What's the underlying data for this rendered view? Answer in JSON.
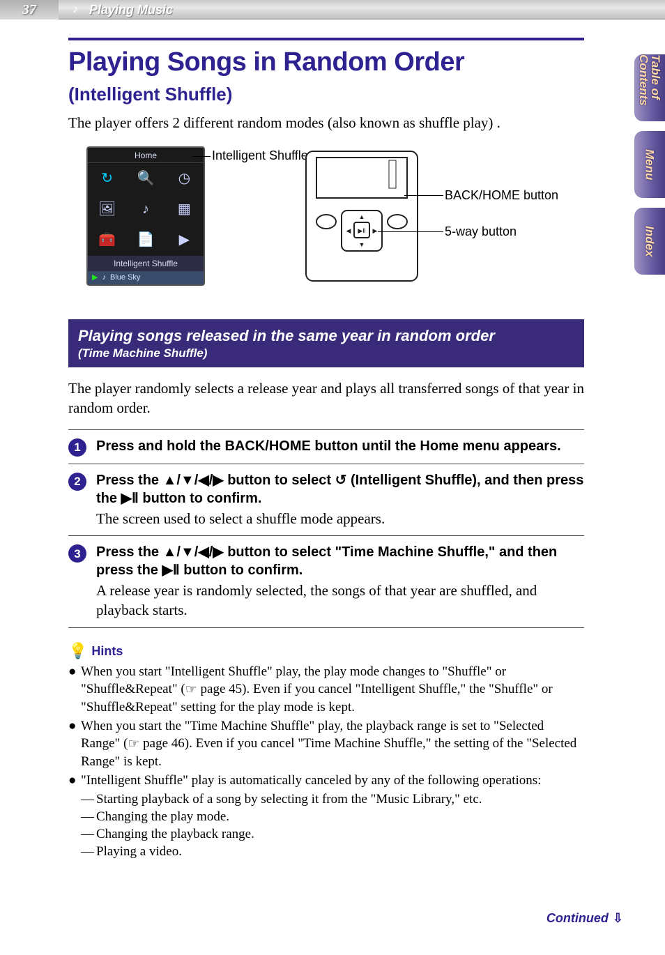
{
  "page_number": "37",
  "top_section": "Playing Music",
  "side_tabs": [
    "Table of Contents",
    "Menu",
    "Index"
  ],
  "title_main": "Playing Songs in Random Order",
  "title_sub": "(Intelligent Shuffle)",
  "intro": "The player offers 2 different random modes (also known as shuffle play) .",
  "device_screen": {
    "title": "Home",
    "selected_label": "Intelligent Shuffle",
    "now_playing": "Blue Sky"
  },
  "fig_labels": {
    "intelligent_shuffle": "Intelligent Shuffle",
    "back_home": "BACK/HOME button",
    "five_way": "5-way button"
  },
  "purple_bar": {
    "main": "Playing songs released in the same year in random order",
    "sub": "(Time Machine Shuffle)"
  },
  "body_after_bar": "The player randomly selects a release year and plays all transferred songs of that year in random order.",
  "steps": [
    {
      "num": "1",
      "bold": "Press and hold the BACK/HOME button until the Home menu appears.",
      "text": ""
    },
    {
      "num": "2",
      "bold_pre": "Press the ",
      "nav": "▲/▼/◀/▶",
      "bold_mid1": " button to select ",
      "icon_name": "intelligent-shuffle-feature-icon",
      "bold_mid2": " (Intelligent Shuffle), and then press the ",
      "play": "▶Ⅱ",
      "bold_post": " button to confirm.",
      "text": "The screen used to select a shuffle mode appears."
    },
    {
      "num": "3",
      "bold_pre": "Press the ",
      "nav": "▲/▼/◀/▶",
      "bold_mid": " button to select \"Time Machine Shuffle,\" and then press the ",
      "play": "▶Ⅱ",
      "bold_post": " button to confirm.",
      "text": "A release year is randomly selected, the songs of that year are shuffled, and playback starts."
    }
  ],
  "hints_title": "Hints",
  "hints": [
    {
      "pre": "When you start \"Intelligent Shuffle\" play, the play mode changes to \"Shuffle\" or \"Shuffle&Repeat\" (",
      "ref": "☞",
      "page": " page 45",
      "post": "). Even if you cancel \"Intelligent Shuffle,\" the \"Shuffle\" or \"Shuffle&Repeat\" setting for the play mode is kept."
    },
    {
      "pre": "When you start the \"Time Machine Shuffle\" play, the playback range is set to \"Selected Range\" (",
      "ref": "☞",
      "page": " page 46",
      "post": "). Even if you cancel \"Time Machine Shuffle,\" the setting of the \"Selected Range\" is kept."
    },
    {
      "line": "\"Intelligent Shuffle\" play is automatically canceled by any of the following operations:",
      "subs": [
        "Starting playback of a song by selecting it from the \"Music Library,\" etc.",
        "Changing the play mode.",
        "Changing the playback range.",
        "Playing a video."
      ]
    }
  ],
  "continued": "Continued"
}
